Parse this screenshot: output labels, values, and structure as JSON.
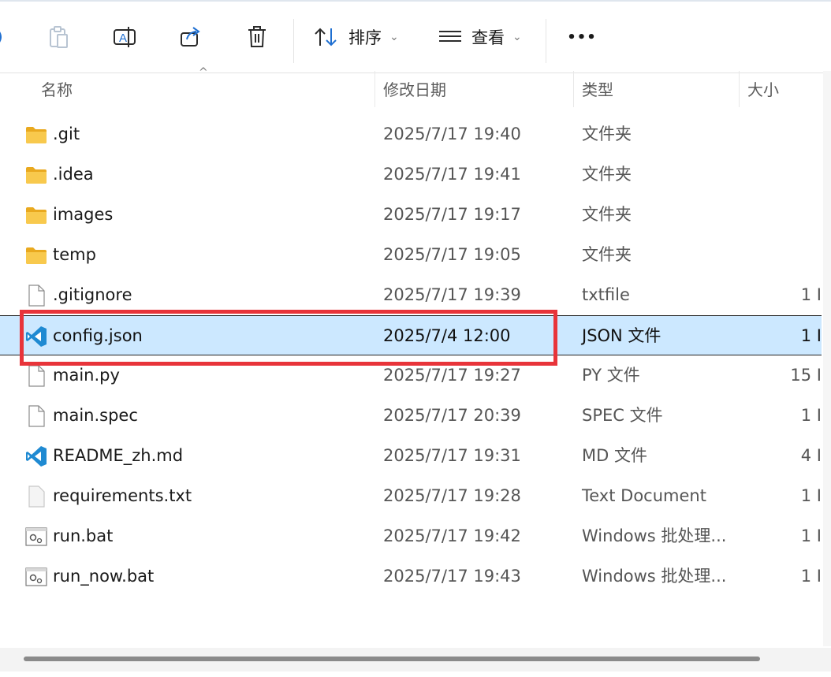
{
  "toolbar": {
    "sort_label": "排序",
    "view_label": "查看",
    "more_label": "•••"
  },
  "columns": {
    "name": "名称",
    "date": "修改日期",
    "type": "类型",
    "size": "大小"
  },
  "files": [
    {
      "name": ".git",
      "date": "2025/7/17 19:40",
      "type": "文件夹",
      "size": "",
      "icon": "folder-icon",
      "selected": false
    },
    {
      "name": ".idea",
      "date": "2025/7/17 19:41",
      "type": "文件夹",
      "size": "",
      "icon": "folder-icon",
      "selected": false
    },
    {
      "name": "images",
      "date": "2025/7/17 19:17",
      "type": "文件夹",
      "size": "",
      "icon": "folder-icon",
      "selected": false
    },
    {
      "name": "temp",
      "date": "2025/7/17 19:05",
      "type": "文件夹",
      "size": "",
      "icon": "folder-icon",
      "selected": false
    },
    {
      "name": ".gitignore",
      "date": "2025/7/17 19:39",
      "type": "txtfile",
      "size": "1 I",
      "icon": "file-icon",
      "selected": false
    },
    {
      "name": "config.json",
      "date": "2025/7/4 12:00",
      "type": "JSON 文件",
      "size": "1 I",
      "icon": "vscode-icon",
      "selected": true
    },
    {
      "name": "main.py",
      "date": "2025/7/17 19:27",
      "type": "PY 文件",
      "size": "15 I",
      "icon": "file-icon",
      "selected": false
    },
    {
      "name": "main.spec",
      "date": "2025/7/17 20:39",
      "type": "SPEC 文件",
      "size": "1 I",
      "icon": "file-icon",
      "selected": false
    },
    {
      "name": "README_zh.md",
      "date": "2025/7/17 19:31",
      "type": "MD 文件",
      "size": "4 I",
      "icon": "vscode-icon",
      "selected": false
    },
    {
      "name": "requirements.txt",
      "date": "2025/7/17 19:28",
      "type": "Text Document",
      "size": "1 I",
      "icon": "text-file-icon",
      "selected": false
    },
    {
      "name": "run.bat",
      "date": "2025/7/17 19:42",
      "type": "Windows 批处理...",
      "size": "1 I",
      "icon": "batch-file-icon",
      "selected": false
    },
    {
      "name": "run_now.bat",
      "date": "2025/7/17 19:43",
      "type": "Windows 批处理...",
      "size": "1 I",
      "icon": "batch-file-icon",
      "selected": false
    }
  ],
  "colors": {
    "selection_bg": "#cce8ff",
    "highlight_border": "#e8343a",
    "folder": "#f8c94d",
    "vscode": "#1f8ad2"
  }
}
